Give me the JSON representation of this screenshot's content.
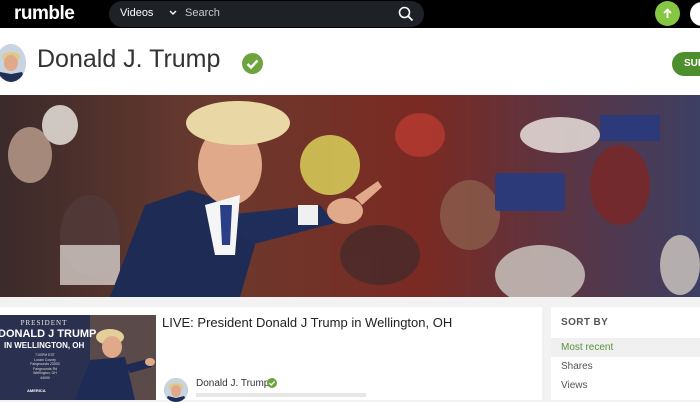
{
  "nav": {
    "logo": "rumble",
    "category": "Videos",
    "search_placeholder": "Search"
  },
  "channel": {
    "name": "Donald J. Trump",
    "subscribe_label": "SUB",
    "accent_color": "#85c742"
  },
  "video": {
    "title": "LIVE: President Donald J Trump in Wellington, OH",
    "channel_name": "Donald J. Trump",
    "thumbnail": {
      "line1": "PRESIDENT",
      "line2": "DONALD J TRUMP",
      "line3": "IN WELLINGTON, OH",
      "details": "7:00PM EST Lorain County Fairgrounds 23000 Fairgrounds Rd Wellington, OH 44090",
      "badge": "AMERICA"
    }
  },
  "sort": {
    "title": "SORT BY",
    "options": [
      "Most recent",
      "Shares",
      "Views"
    ],
    "selected": "Most recent"
  },
  "icons": [
    "chevron-down-icon",
    "search-icon",
    "upload-icon",
    "verified-icon"
  ]
}
